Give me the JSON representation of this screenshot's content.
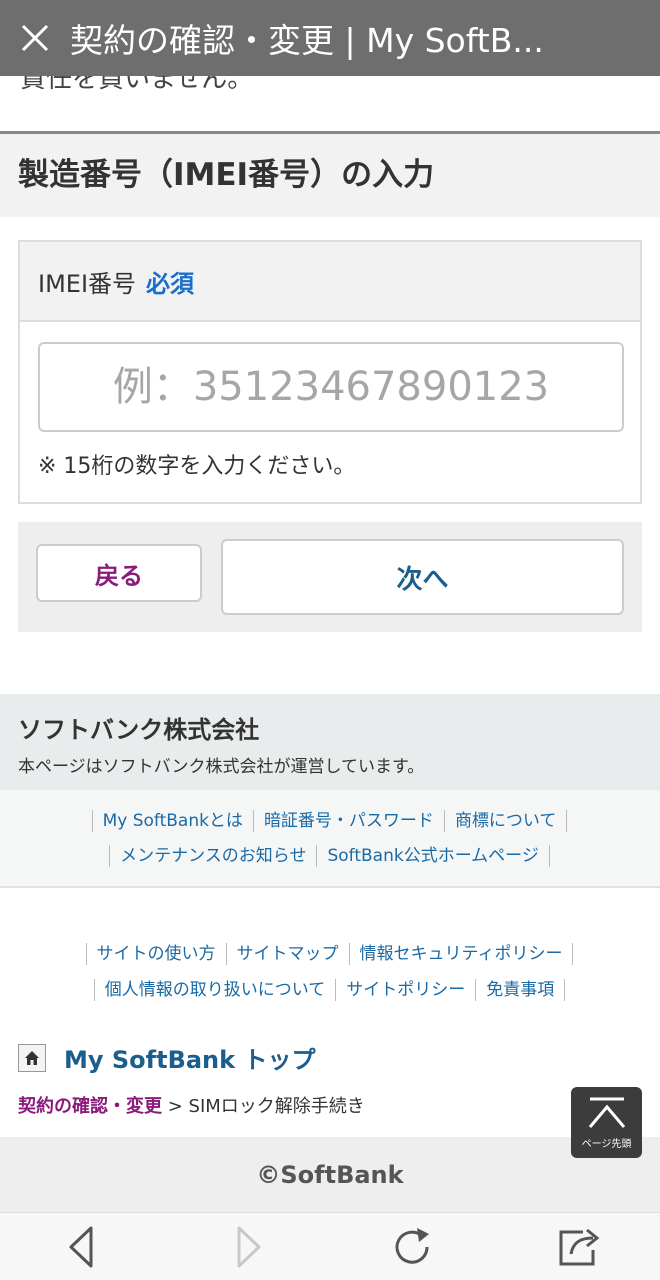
{
  "browser": {
    "title": "契約の確認・変更 | My SoftB...",
    "icons": {
      "close": "close-icon",
      "back": "back-arrow-icon",
      "forward": "forward-arrow-icon",
      "reload": "reload-icon",
      "share": "share-icon"
    }
  },
  "page": {
    "cut_text": "責任を負いません。",
    "section_title": "製造番号（IMEI番号）の入力",
    "form": {
      "label": "IMEI番号",
      "required": "必須",
      "placeholder": "例：35123467890123",
      "value": "",
      "note": "※ 15桁の数字を入力ください。"
    },
    "buttons": {
      "back": "戻る",
      "next": "次へ"
    }
  },
  "corp": {
    "name": "ソフトバンク株式会社",
    "desc": "本ページはソフトバンク株式会社が運営しています。"
  },
  "links_primary": [
    [
      "My SoftBankとは",
      "暗証番号・パスワード",
      "商標について"
    ],
    [
      "メンテナンスのお知らせ",
      "SoftBank公式ホームページ"
    ]
  ],
  "links_secondary": [
    [
      "サイトの使い方",
      "サイトマップ",
      "情報セキュリティポリシー"
    ],
    [
      "個人情報の取り扱いについて",
      "サイトポリシー",
      "免責事項"
    ]
  ],
  "home_link": "My SoftBank トップ",
  "breadcrumb": {
    "link": "契約の確認・変更",
    "sep": " > ",
    "current": "SIMロック解除手続き"
  },
  "page_top": "ページ先頭",
  "footer": "©SoftBank",
  "colors": {
    "topbar": "#6e6e6e",
    "required": "#1a6fc9",
    "back_button": "#8a1b7c",
    "next_button": "#1b5e8e",
    "link": "#1a6aa6"
  }
}
